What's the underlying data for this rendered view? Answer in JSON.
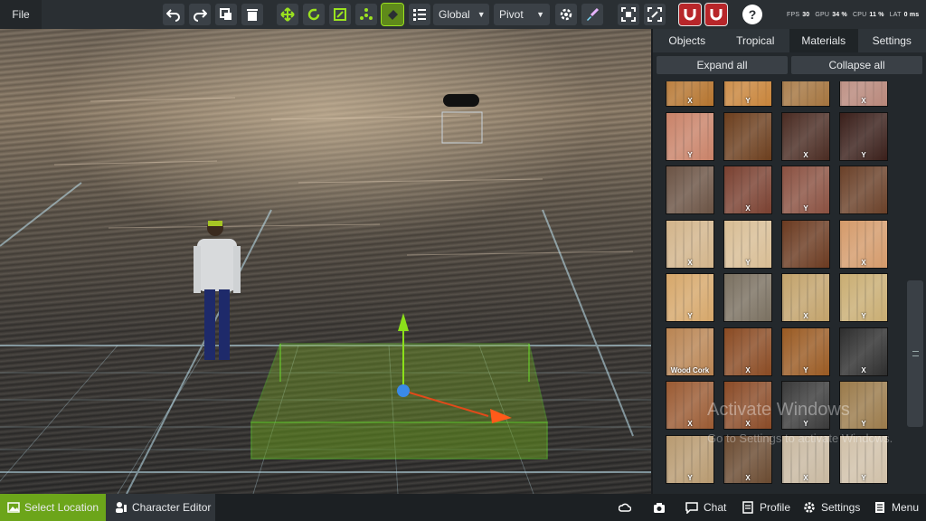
{
  "topbar": {
    "file_label": "File",
    "space_select": "Global",
    "pivot_select": "Pivot",
    "help_label": "?",
    "stats": {
      "fps_label": "FPS",
      "fps_value": "30",
      "gpu_label": "GPU",
      "gpu_value": "34 %",
      "cpu_label": "CPU",
      "cpu_value": "11 %",
      "lat_label": "LAT",
      "lat_value": "0 ms"
    }
  },
  "panel": {
    "tabs": [
      "Objects",
      "Tropical",
      "Materials",
      "Settings"
    ],
    "active_tab": "Materials",
    "expand_label": "Expand all",
    "collapse_label": "Collapse all",
    "tiles": [
      {
        "tag": "X",
        "color": "#b5742e"
      },
      {
        "tag": "Y",
        "color": "#c8843a"
      },
      {
        "tag": "",
        "color": "#a4743e"
      },
      {
        "tag": "X",
        "color": "#b8877a"
      },
      {
        "tag": "Y",
        "color": "#c98268"
      },
      {
        "tag": "",
        "color": "#6c3e1d"
      },
      {
        "tag": "X",
        "color": "#4a2b22"
      },
      {
        "tag": "Y",
        "color": "#3a1f1a"
      },
      {
        "tag": "",
        "color": "#6b5344"
      },
      {
        "tag": "X",
        "color": "#7a4030"
      },
      {
        "tag": "Y",
        "color": "#8a5040"
      },
      {
        "tag": "",
        "color": "#6a4028"
      },
      {
        "tag": "X",
        "color": "#d2b48a"
      },
      {
        "tag": "Y",
        "color": "#d8bd94"
      },
      {
        "tag": "",
        "color": "#6b3a20"
      },
      {
        "tag": "X",
        "color": "#d49a6a"
      },
      {
        "tag": "Y",
        "color": "#d6a76a"
      },
      {
        "tag": "",
        "color": "#7a7060"
      },
      {
        "tag": "X",
        "color": "#c2a26a"
      },
      {
        "tag": "Y",
        "color": "#c9ad72"
      },
      {
        "tag": "Wood Cork",
        "color": "#b98452"
      },
      {
        "tag": "X",
        "color": "#8a4a22"
      },
      {
        "tag": "Y",
        "color": "#9a5a22"
      },
      {
        "tag": "X",
        "color": "#2e2e2e"
      },
      {
        "tag": "X",
        "color": "#9a5a32"
      },
      {
        "tag": "X",
        "color": "#8a4a26"
      },
      {
        "tag": "Y",
        "color": "#3a3a3a"
      },
      {
        "tag": "Y",
        "color": "#9a7a4a"
      },
      {
        "tag": "Y",
        "color": "#b89a70"
      },
      {
        "tag": "X",
        "color": "#6a4a30"
      },
      {
        "tag": "X",
        "color": "#c8b8a0"
      },
      {
        "tag": "Y",
        "color": "#d0c0a8"
      }
    ]
  },
  "watermark": {
    "title": "Activate Windows",
    "subtitle": "Go to Settings to activate Windows."
  },
  "bottombar": {
    "select_location": "Select Location",
    "character_editor": "Character Editor",
    "chat": "Chat",
    "profile": "Profile",
    "settings": "Settings",
    "menu": "Menu"
  },
  "colors": {
    "accent": "#6ca51a",
    "toolbar": "#2a2f33",
    "panel": "#23282c"
  }
}
